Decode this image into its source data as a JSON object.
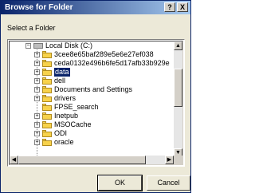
{
  "window": {
    "title": "Browse for Folder",
    "help_label": "?",
    "close_label": "X"
  },
  "dialog": {
    "prompt": "Select a Folder"
  },
  "tree": {
    "root": {
      "label": "Local Disk (C:)",
      "expander": "−"
    },
    "items": [
      {
        "label": "3cee8e65baf289e5e6e27ef038",
        "expander": "+"
      },
      {
        "label": "ceda0132e496b6fe5d17afb33b929e",
        "expander": "+"
      },
      {
        "label": "data",
        "expander": "+",
        "selected": true
      },
      {
        "label": "dell",
        "expander": "+"
      },
      {
        "label": "Documents and Settings",
        "expander": "+"
      },
      {
        "label": "drivers",
        "expander": "+"
      },
      {
        "label": "FPSE_search",
        "expander": ""
      },
      {
        "label": "Inetpub",
        "expander": "+"
      },
      {
        "label": "MSOCache",
        "expander": "+"
      },
      {
        "label": "ODI",
        "expander": "+"
      },
      {
        "label": "oracle",
        "expander": "+"
      }
    ]
  },
  "buttons": {
    "ok": "OK",
    "cancel": "Cancel"
  }
}
